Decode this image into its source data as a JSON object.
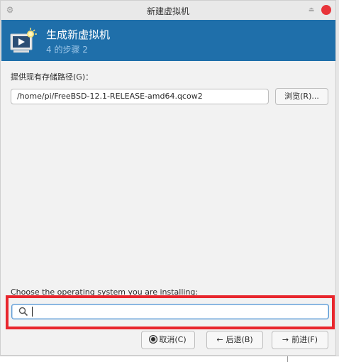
{
  "window": {
    "title": "新建虚拟机"
  },
  "header": {
    "title": "生成新虚拟机",
    "step": "4 的步骤 2"
  },
  "storage": {
    "label": "提供现有存储路径(G)：",
    "path_value": "/home/pi/FreeBSD-12.1-RELEASE-amd64.qcow2",
    "browse_label": "浏览(R)..."
  },
  "os": {
    "label": "Choose the operating system you are installing:",
    "search_value": ""
  },
  "footer": {
    "cancel_label": "取消(C)",
    "back_label": "后退(B)",
    "next_label": "前进(F)"
  },
  "icons": {
    "settings": "gear-icon",
    "minimize": "eject-icon",
    "close": "close-icon",
    "vm": "vm-play-icon",
    "search": "search-icon",
    "back_arrow": "arrow-left-icon",
    "next_arrow": "arrow-right-icon",
    "cancel": "stop-icon"
  },
  "colors": {
    "banner": "#1f6faa",
    "close": "#e8343a",
    "highlight_frame": "#e8262d",
    "focus": "#5b9ad5"
  }
}
